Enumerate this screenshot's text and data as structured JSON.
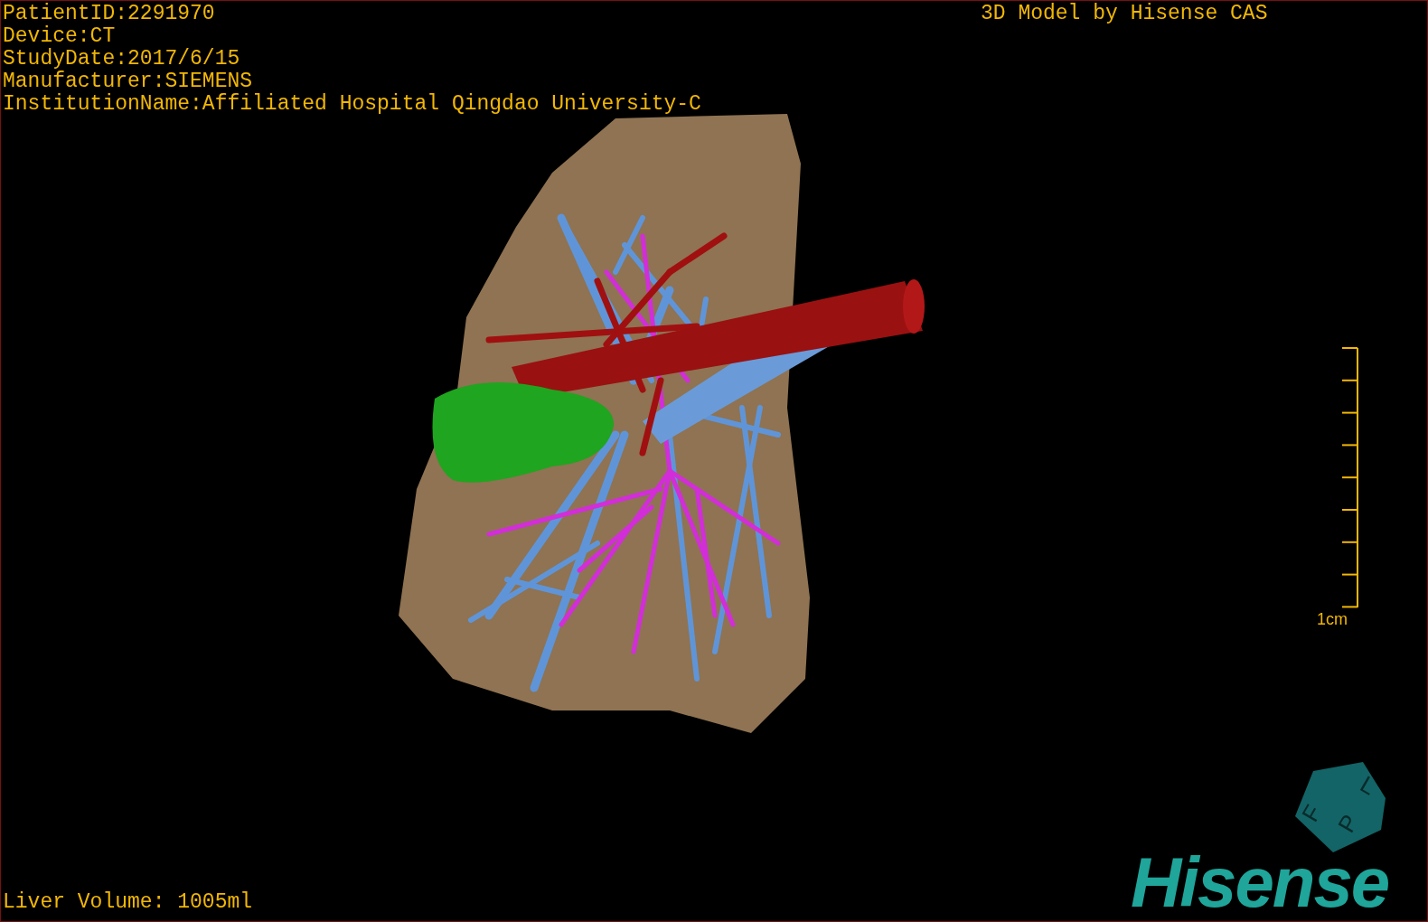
{
  "patient_info": [
    "PatientID:2291970",
    "Device:CT",
    "StudyDate:2017/6/15",
    "Manufacturer:SIEMENS",
    "InstitutionName:Affiliated Hospital Qingdao University-C"
  ],
  "header_right": "3D Model by Hisense CAS",
  "scale_bar": {
    "label": "1cm"
  },
  "orientation_cube": {
    "labels": [
      "F",
      "L",
      "P"
    ]
  },
  "logo": "Hisense",
  "liver_volume": "Liver Volume: 1005ml"
}
